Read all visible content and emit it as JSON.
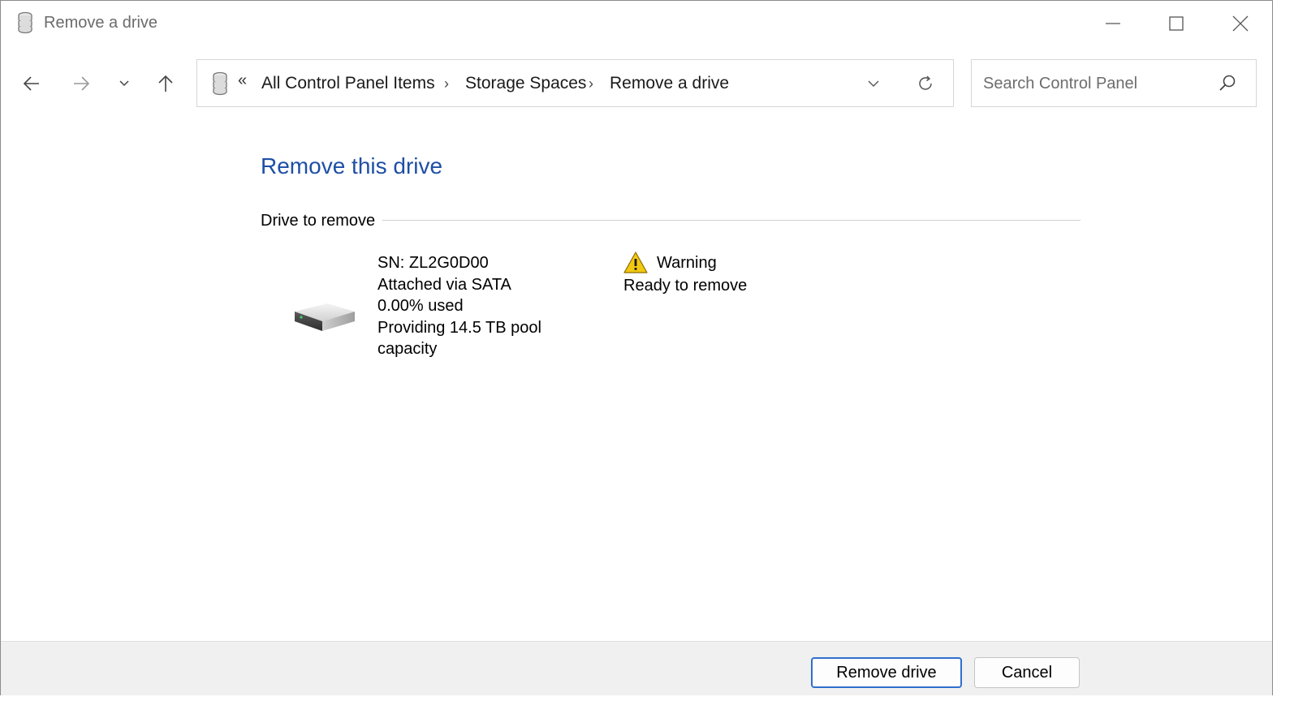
{
  "window": {
    "title": "Remove a drive",
    "icon": "storage-spaces-icon"
  },
  "nav": {
    "back_icon": "arrow-left-icon",
    "forward_icon": "arrow-right-icon",
    "recent_icon": "chevron-down-icon",
    "up_icon": "arrow-up-icon"
  },
  "address": {
    "overflow": "«",
    "breadcrumbs": [
      "All Control Panel Items",
      "Storage Spaces",
      "Remove a drive"
    ],
    "separator": "›"
  },
  "search": {
    "placeholder": "Search Control Panel"
  },
  "main": {
    "title": "Remove this drive",
    "group_label": "Drive to remove",
    "drive": {
      "serial": "SN: ZL2G0D00",
      "connection": "Attached via SATA",
      "usage": "0.00% used",
      "capacity": "Providing 14.5 TB pool capacity"
    },
    "status": {
      "label": "Warning",
      "detail": "Ready to remove"
    }
  },
  "footer": {
    "primary_label": "Remove drive",
    "cancel_label": "Cancel"
  },
  "colors": {
    "accent": "#1e4fa6",
    "button_focus": "#2f6fcf",
    "footer_bg": "#f0f0f0",
    "warning": "#f2c811"
  }
}
